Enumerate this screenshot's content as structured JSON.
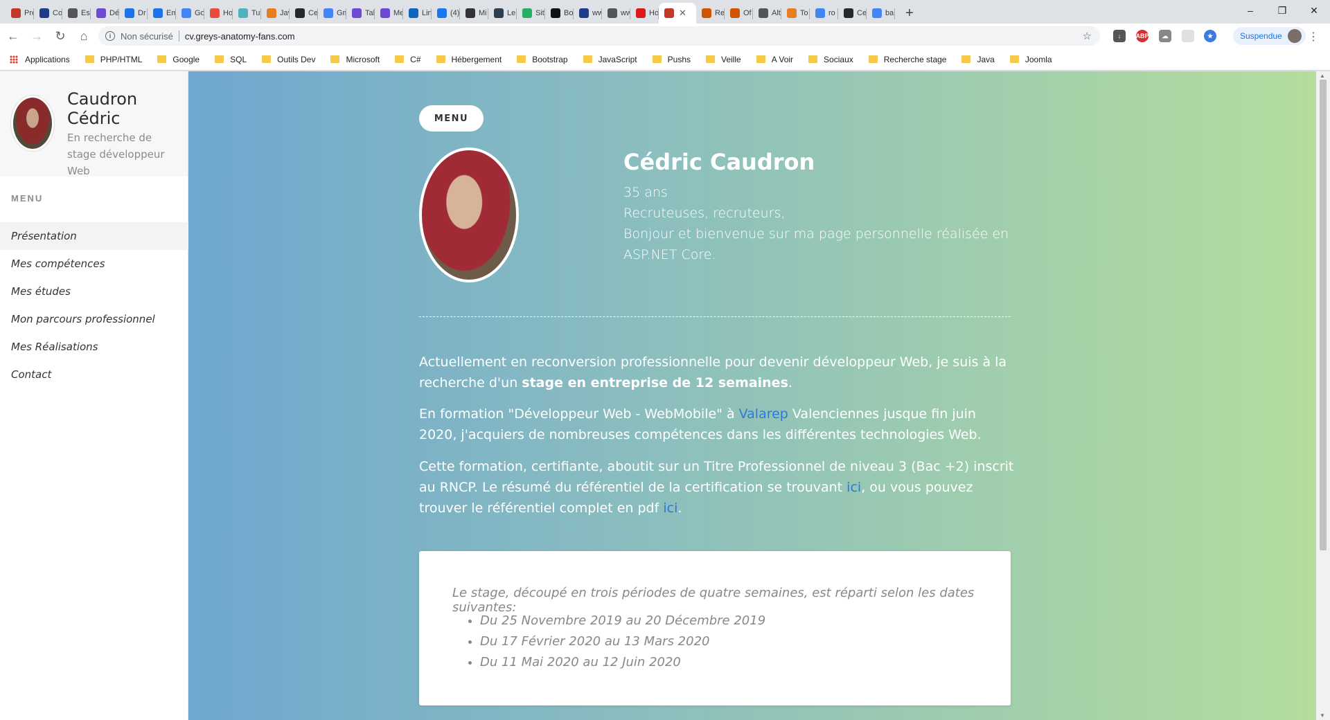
{
  "browser": {
    "tabs": [
      {
        "label": "Pre",
        "color": "#c0392b"
      },
      {
        "label": "Co",
        "color": "#1f3c88"
      },
      {
        "label": "Esp",
        "color": "#555555"
      },
      {
        "label": "Dé",
        "color": "#6c4ad1"
      },
      {
        "label": "Dr",
        "color": "#1a73e8"
      },
      {
        "label": "Em",
        "color": "#1a73e8"
      },
      {
        "label": "Go",
        "color": "#4285f4"
      },
      {
        "label": "Ho",
        "color": "#e74c3c"
      },
      {
        "label": "Tut",
        "color": "#4fb3bf"
      },
      {
        "label": "Jav",
        "color": "#e67e22"
      },
      {
        "label": "Ce",
        "color": "#24292e"
      },
      {
        "label": "Gm",
        "color": "#4285f4"
      },
      {
        "label": "Tal",
        "color": "#6c4ad1"
      },
      {
        "label": "Me",
        "color": "#6c4ad1"
      },
      {
        "label": "Lin",
        "color": "#0a66c2"
      },
      {
        "label": "(4)",
        "color": "#1877f2"
      },
      {
        "label": "Mi",
        "color": "#333333"
      },
      {
        "label": "Le",
        "color": "#2c3e50"
      },
      {
        "label": "Sit",
        "color": "#27ae60"
      },
      {
        "label": "Bo",
        "color": "#111111"
      },
      {
        "label": "ww",
        "color": "#1f3c88"
      },
      {
        "label": "ww",
        "color": "#555555"
      },
      {
        "label": "Ho",
        "color": "#dd1b16"
      },
      {
        "label": "",
        "color": "#c0392b",
        "active": true
      },
      {
        "label": "Re",
        "color": "#d35400"
      },
      {
        "label": "Of",
        "color": "#d35400"
      },
      {
        "label": "Alt",
        "color": "#555555"
      },
      {
        "label": "To",
        "color": "#e67e22"
      },
      {
        "label": "ro",
        "color": "#4285f4"
      },
      {
        "label": "Ce",
        "color": "#24292e"
      },
      {
        "label": "ba",
        "color": "#4285f4"
      }
    ],
    "new_tab": "+",
    "window_controls": [
      "–",
      "❐",
      "✕"
    ],
    "nav": {
      "back": "←",
      "forward": "→",
      "reload": "↻",
      "home": "⌂"
    },
    "omnibox": {
      "security": "Non sécurisé",
      "url": "cv.greys-anatomy-fans.com",
      "star": "☆"
    },
    "profile_label": "Suspendue",
    "bookmarks": [
      "PHP/HTML",
      "Google",
      "SQL",
      "Outils Dev",
      "Microsoft",
      "C#",
      "Hébergement",
      "Bootstrap",
      "JavaScript",
      "Pushs",
      "Veille",
      "A Voir",
      "Sociaux",
      "Recherche stage",
      "Java",
      "Joomla"
    ],
    "apps_label": "Applications"
  },
  "sidebar": {
    "name": "Caudron Cédric",
    "subtitle": "En recherche de stage développeur Web",
    "menu_title": "MENU",
    "items": [
      {
        "label": "Présentation",
        "active": true
      },
      {
        "label": "Mes compétences"
      },
      {
        "label": "Mes études"
      },
      {
        "label": "Mon parcours professionnel"
      },
      {
        "label": "Mes Réalisations"
      },
      {
        "label": "Contact"
      }
    ]
  },
  "main": {
    "menu_button": "MENU",
    "hero": {
      "name": "Cédric Caudron",
      "age": "35 ans",
      "greeting": "Recruteuses, recruteurs,",
      "welcome": "Bonjour et bienvenue sur ma page personnelle réalisée en ASP.NET Core."
    },
    "p1_a": "Actuellement en reconversion professionnelle pour devenir développeur Web, je suis à la recherche d'un ",
    "p1_bold": "stage en entreprise de 12 semaines",
    "p1_end": ".",
    "p2_a": "En formation \"Développeur Web - WebMobile\" à ",
    "p2_link": "Valarep",
    "p2_b": " Valenciennes jusque fin juin 2020, j'acquiers de nombreuses compétences dans les différentes technologies Web.",
    "p3_a": "Cette formation, certifiante, aboutit sur un Titre Professionnel de niveau 3 (Bac +2) inscrit au RNCP. Le résumé du référentiel de la certification se trouvant ",
    "p3_link1": "ici",
    "p3_b": ", ou vous pouvez trouver le référentiel complet en pdf ",
    "p3_link2": "ici",
    "p3_end": ".",
    "card": {
      "intro": "Le stage, découpé en trois périodes de quatre semaines, est réparti selon les dates suivantes:",
      "dates": [
        "Du 25 Novembre 2019 au 20 Décembre 2019",
        "Du 17 Février 2020 au 13 Mars 2020",
        "Du 11 Mai 2020 au 12 Juin 2020"
      ]
    }
  }
}
